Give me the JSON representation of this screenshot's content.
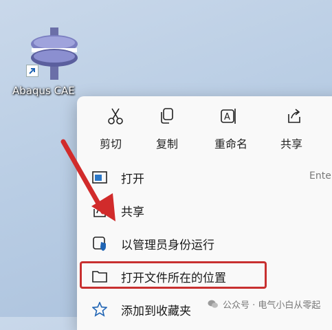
{
  "desktop_icon": {
    "label": "Abaqus CAE"
  },
  "quick_actions": [
    {
      "label": "剪切",
      "icon": "scissors-icon"
    },
    {
      "label": "复制",
      "icon": "copy-icon"
    },
    {
      "label": "重命名",
      "icon": "rename-icon"
    },
    {
      "label": "共享",
      "icon": "share-icon"
    }
  ],
  "menu_items": [
    {
      "label": "打开",
      "shortcut": "Ente",
      "icon": "open-app-icon"
    },
    {
      "label": "共享",
      "icon": "share-icon"
    },
    {
      "label": "以管理员身份运行",
      "icon": "shield-icon"
    },
    {
      "label": "打开文件所在的位置",
      "icon": "folder-icon",
      "highlighted": true
    },
    {
      "label": "添加到收藏夹",
      "icon": "star-icon"
    }
  ],
  "watermark": {
    "text": "公众号 · 电气小白从零起"
  },
  "colors": {
    "highlight": "#c83030",
    "arrow": "#d12b2b",
    "accent": "#1f64b4"
  }
}
